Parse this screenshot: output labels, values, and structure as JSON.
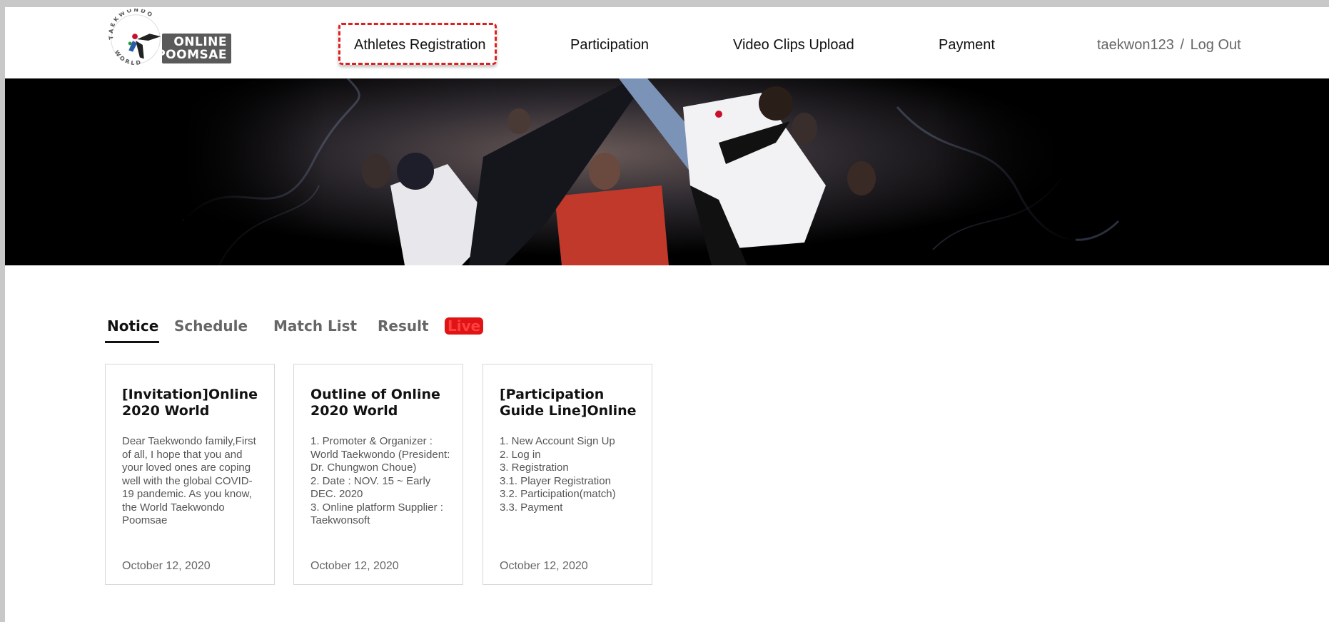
{
  "header": {
    "logo": {
      "ring_text": "TAEKWONDO WORLD",
      "line1": "ONLINE",
      "line2": "POOMSAE"
    },
    "nav": [
      {
        "label": "Athletes Registration"
      },
      {
        "label": "Participation"
      },
      {
        "label": "Video Clips Upload"
      },
      {
        "label": "Payment"
      }
    ],
    "user": {
      "username": "taekwon123",
      "separator": "/",
      "logout": "Log Out"
    }
  },
  "tabs": [
    {
      "label": "Notice"
    },
    {
      "label": "Schedule"
    },
    {
      "label": "Match List"
    },
    {
      "label": "Result"
    },
    {
      "label": "Live"
    }
  ],
  "cards": [
    {
      "title": "[Invitation]Online 2020 World",
      "body": "Dear Taekwondo family,First of all, I hope that you and your loved ones are coping well with the global COVID-19 pandemic. As you know, the World Taekwondo Poomsae",
      "date": "October 12, 2020"
    },
    {
      "title": "Outline of Online 2020 World",
      "body": "1. Promoter & Organizer : World Taekwondo (President: Dr. Chungwon Choue)\n2. Date : NOV. 15 ~ Early DEC. 2020\n3. Online platform Supplier : Taekwonsoft",
      "date": "October 12, 2020"
    },
    {
      "title": "[Participation Guide Line]Online",
      "body": "1. New Account Sign Up\n2. Log in\n3. Registration\n3.1. Player Registration\n3.2. Participation(match)\n3.3. Payment",
      "date": "October 12, 2020"
    }
  ],
  "colors": {
    "accent_red": "#e01f1f",
    "logo_gray": "#5a5a5a",
    "live_badge": "#e01414"
  },
  "icons": {
    "logo": "taekwondo-kicker-logo"
  }
}
